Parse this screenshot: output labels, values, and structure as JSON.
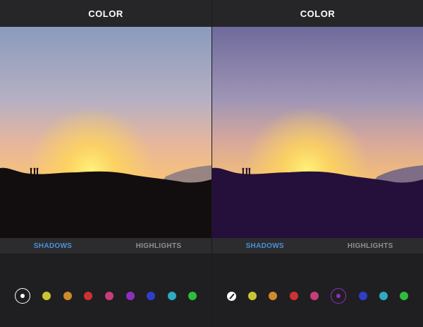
{
  "left": {
    "title": "COLOR",
    "tabs": [
      {
        "label": "SHADOWS",
        "active": true
      },
      {
        "label": "HIGHLIGHTS",
        "active": false
      }
    ],
    "selected_swatch": "none",
    "swatches": [
      {
        "name": "none",
        "color": "#ffffff"
      },
      {
        "name": "yellow",
        "color": "#c9c436"
      },
      {
        "name": "orange",
        "color": "#d08a2e"
      },
      {
        "name": "red",
        "color": "#d0312f"
      },
      {
        "name": "pink",
        "color": "#c93c7a"
      },
      {
        "name": "purple",
        "color": "#8e2fc0"
      },
      {
        "name": "blue",
        "color": "#2f3ec9"
      },
      {
        "name": "cyan",
        "color": "#2fa9c4"
      },
      {
        "name": "green",
        "color": "#2fbd3c"
      }
    ]
  },
  "right": {
    "title": "COLOR",
    "tabs": [
      {
        "label": "SHADOWS",
        "active": true
      },
      {
        "label": "HIGHLIGHTS",
        "active": false
      }
    ],
    "selected_swatch": "purple",
    "swatches": [
      {
        "name": "none",
        "color": "#ffffff"
      },
      {
        "name": "yellow",
        "color": "#c9c436"
      },
      {
        "name": "orange",
        "color": "#d08a2e"
      },
      {
        "name": "red",
        "color": "#d0312f"
      },
      {
        "name": "pink",
        "color": "#c93c7a"
      },
      {
        "name": "purple",
        "color": "#8e2fc0"
      },
      {
        "name": "blue",
        "color": "#2f3ec9"
      },
      {
        "name": "cyan",
        "color": "#2fa9c4"
      },
      {
        "name": "green",
        "color": "#2fbd3c"
      }
    ]
  },
  "colors": {
    "accent": "#4a90d9",
    "tab_inactive": "#8e8e93",
    "background": "#1f1f21",
    "shadow_tint": "#24103a"
  }
}
